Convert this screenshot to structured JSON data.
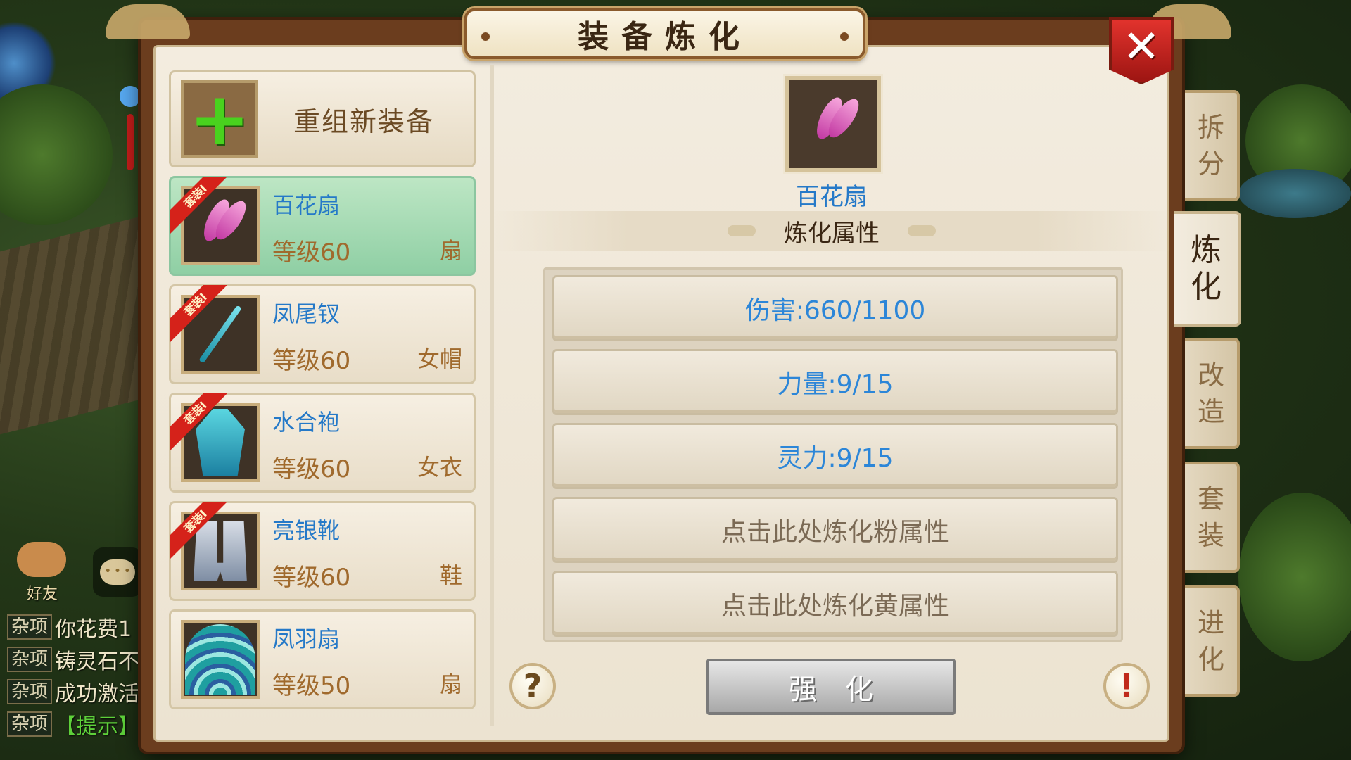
{
  "title": "装备炼化",
  "close_label": "✕",
  "new_equip": {
    "label": "重组新装备",
    "icon": "plus-icon"
  },
  "items": [
    {
      "badge": "套装I",
      "name": "百花扇",
      "level": "等级60",
      "type": "扇",
      "icon": "pink-fan-icon",
      "selected": true
    },
    {
      "badge": "套装I",
      "name": "凤尾钗",
      "level": "等级60",
      "type": "女帽",
      "icon": "hairpin-icon",
      "selected": false
    },
    {
      "badge": "套装I",
      "name": "水合袍",
      "level": "等级60",
      "type": "女衣",
      "icon": "robe-icon",
      "selected": false
    },
    {
      "badge": "套装I",
      "name": "亮银靴",
      "level": "等级60",
      "type": "鞋",
      "icon": "boots-icon",
      "selected": false
    },
    {
      "badge": "",
      "name": "凤羽扇",
      "level": "等级50",
      "type": "扇",
      "icon": "peacock-fan-icon",
      "selected": false
    }
  ],
  "detail": {
    "equip_name": "百花扇",
    "section_title": "炼化属性",
    "attributes": [
      {
        "text": "伤害:660/1100",
        "kind": "stat"
      },
      {
        "text": "力量:9/15",
        "kind": "stat"
      },
      {
        "text": "灵力:9/15",
        "kind": "stat"
      },
      {
        "text": "点击此处炼化粉属性",
        "kind": "action"
      },
      {
        "text": "点击此处炼化黄属性",
        "kind": "action"
      }
    ],
    "help_label": "?",
    "info_label": "!",
    "strengthen_label": "强化"
  },
  "side_tabs": [
    {
      "chars": [
        "拆",
        "分"
      ],
      "active": false
    },
    {
      "chars": [
        "炼",
        "化"
      ],
      "active": true
    },
    {
      "chars": [
        "改",
        "造"
      ],
      "active": false
    },
    {
      "chars": [
        "套",
        "装"
      ],
      "active": false
    },
    {
      "chars": [
        "进",
        "化"
      ],
      "active": false
    }
  ],
  "friend_label": "好友",
  "chat": [
    {
      "tag": "杂项",
      "text": "你花费1",
      "color": "normal"
    },
    {
      "tag": "杂项",
      "text": "铸灵石不",
      "color": "normal"
    },
    {
      "tag": "杂项",
      "text": "成功激活",
      "color": "normal"
    },
    {
      "tag": "杂项",
      "text": "【提示】",
      "color": "green"
    }
  ]
}
